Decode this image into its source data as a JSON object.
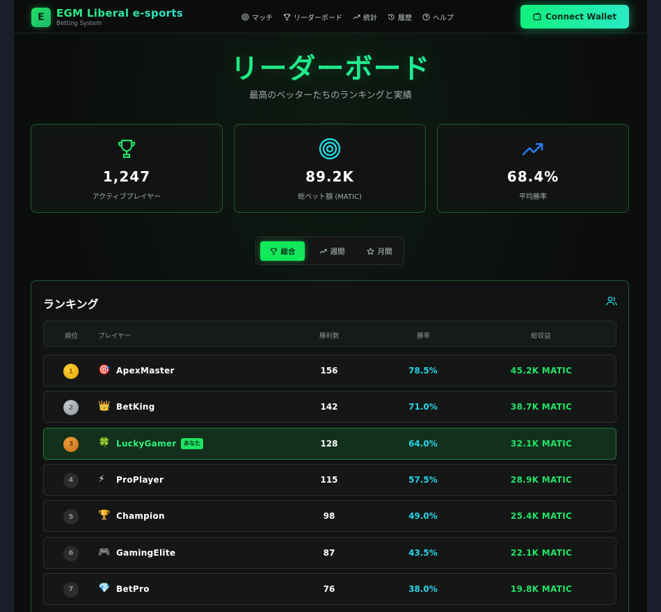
{
  "header": {
    "logo_letter": "E",
    "title": "EGM Liberal e-sports",
    "subtitle": "Betting System",
    "nav": [
      {
        "icon": "target-icon",
        "label": "マッチ"
      },
      {
        "icon": "trophy-icon",
        "label": "リーダーボード"
      },
      {
        "icon": "trend-icon",
        "label": "統計"
      },
      {
        "icon": "history-icon",
        "label": "履歴"
      },
      {
        "icon": "help-icon",
        "label": "ヘルプ"
      }
    ],
    "connect_label": "Connect Wallet"
  },
  "hero": {
    "title": "リーダーボード",
    "subtitle": "最高のベッターたちのランキングと実績"
  },
  "stats": [
    {
      "icon": "trophy-icon",
      "value": "1,247",
      "label": "アクティブプレイヤー",
      "color": "#22e06a"
    },
    {
      "icon": "target-icon",
      "value": "89.2K",
      "label": "総ベット額 (MATIC)",
      "color": "#22d8e0"
    },
    {
      "icon": "trend-up-icon",
      "value": "68.4%",
      "label": "平均勝率",
      "color": "#2a7bf0"
    }
  ],
  "tabs": [
    {
      "label": "総合",
      "active": true
    },
    {
      "label": "週間",
      "active": false
    },
    {
      "label": "月間",
      "active": false
    }
  ],
  "ranking": {
    "title": "ランキング",
    "columns": {
      "rank": "順位",
      "player": "プレイヤー",
      "wins": "勝利数",
      "rate": "勝率",
      "earnings": "総収益"
    },
    "you_label": "あなた",
    "rows": [
      {
        "rank": "1",
        "medal": "gold",
        "emoji": "🎯",
        "name": "ApexMaster",
        "wins": "156",
        "rate": "78.5%",
        "earnings": "45.2K MATIC",
        "me": false
      },
      {
        "rank": "2",
        "medal": "silver",
        "emoji": "👑",
        "name": "BetKing",
        "wins": "142",
        "rate": "71.0%",
        "earnings": "38.7K MATIC",
        "me": false
      },
      {
        "rank": "3",
        "medal": "bronze",
        "emoji": "🍀",
        "name": "LuckyGamer",
        "wins": "128",
        "rate": "64.0%",
        "earnings": "32.1K MATIC",
        "me": true
      },
      {
        "rank": "4",
        "medal": "plain",
        "emoji": "⚡",
        "name": "ProPlayer",
        "wins": "115",
        "rate": "57.5%",
        "earnings": "28.9K MATIC",
        "me": false
      },
      {
        "rank": "5",
        "medal": "plain",
        "emoji": "🏆",
        "name": "Champion",
        "wins": "98",
        "rate": "49.0%",
        "earnings": "25.4K MATIC",
        "me": false
      },
      {
        "rank": "6",
        "medal": "plain",
        "emoji": "🎮",
        "name": "GamingElite",
        "wins": "87",
        "rate": "43.5%",
        "earnings": "22.1K MATIC",
        "me": false
      },
      {
        "rank": "7",
        "medal": "plain",
        "emoji": "💎",
        "name": "BetPro",
        "wins": "76",
        "rate": "38.0%",
        "earnings": "19.8K MATIC",
        "me": false
      }
    ]
  }
}
